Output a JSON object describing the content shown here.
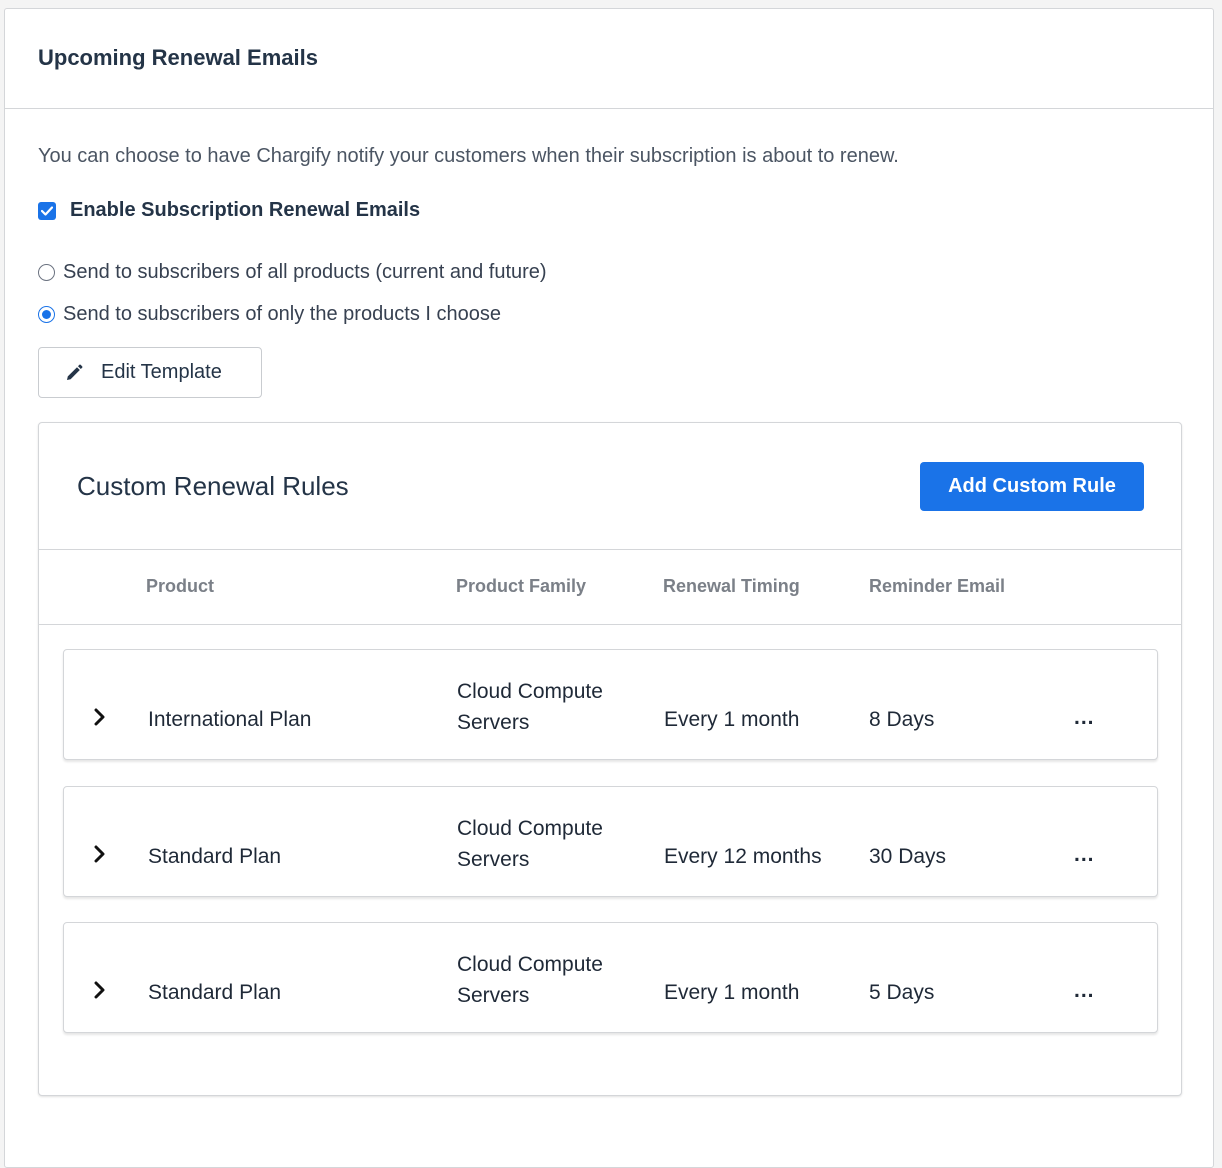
{
  "section": {
    "title": "Upcoming Renewal Emails",
    "intro": "You can choose to have Chargify notify your customers when their subscription is about to renew.",
    "enable_label": "Enable Subscription Renewal Emails",
    "enable_checked": true,
    "radio_all": "Send to subscribers of all products (current and future)",
    "radio_chosen": "Send to subscribers of only the products I choose",
    "selected_radio": "chosen",
    "edit_template_label": "Edit Template"
  },
  "rules": {
    "title": "Custom Renewal Rules",
    "add_button": "Add Custom Rule",
    "columns": {
      "product": "Product",
      "family": "Product Family",
      "timing": "Renewal Timing",
      "reminder": "Reminder Email"
    },
    "rows": [
      {
        "product": "International Plan",
        "family": "Cloud Compute Servers",
        "timing": "Every 1 month",
        "reminder": "8 Days",
        "more": "..."
      },
      {
        "product": "Standard Plan",
        "family": "Cloud Compute Servers",
        "timing": "Every 12 months",
        "reminder": "30 Days",
        "more": "..."
      },
      {
        "product": "Standard Plan",
        "family": "Cloud Compute Servers",
        "timing": "Every 1 month",
        "reminder": "5 Days",
        "more": "..."
      }
    ]
  },
  "colors": {
    "accent": "#1a73e8",
    "heading": "#243447",
    "border": "#d4d6d9"
  },
  "icons": {
    "checkbox": "checkmark-icon",
    "edit": "pencil-icon",
    "expand": "chevron-right-icon"
  }
}
